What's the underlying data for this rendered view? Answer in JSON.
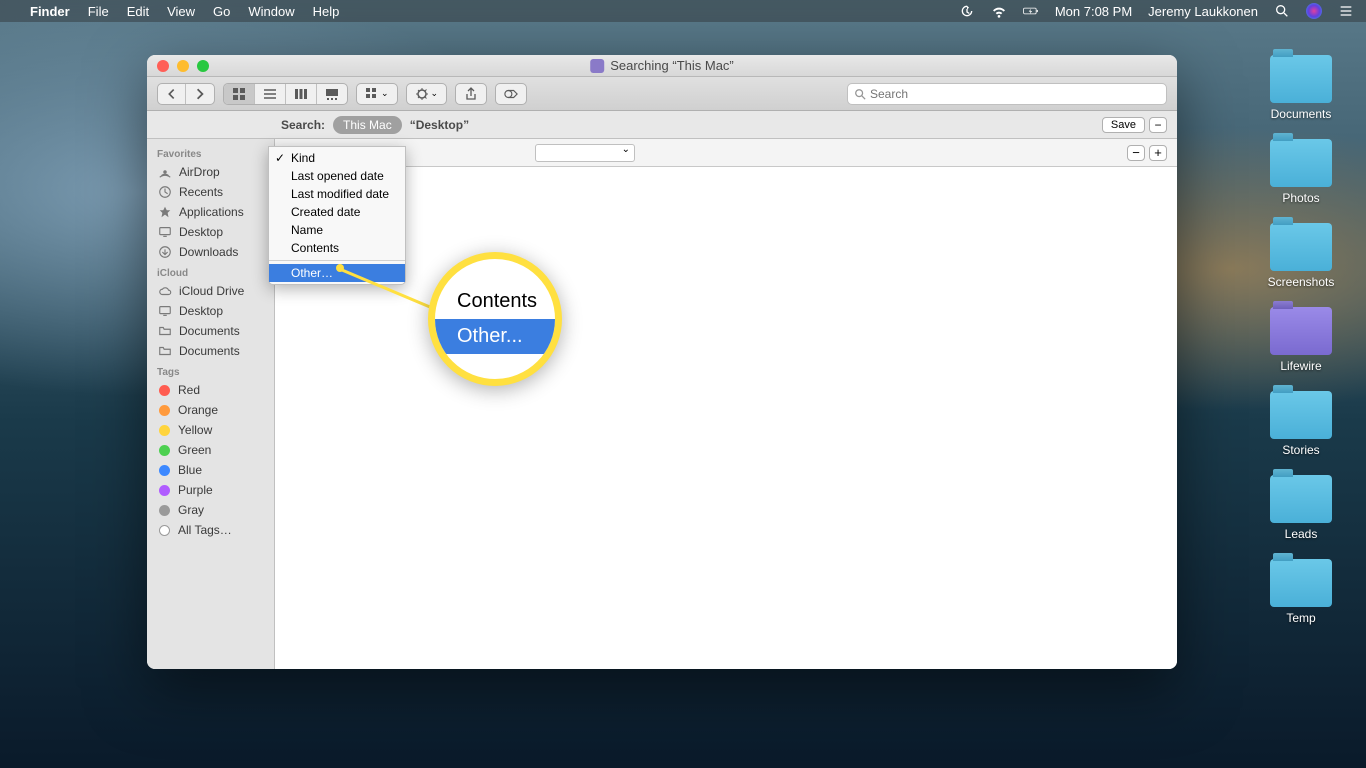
{
  "menubar": {
    "app": "Finder",
    "items": [
      "File",
      "Edit",
      "View",
      "Go",
      "Window",
      "Help"
    ],
    "clock": "Mon 7:08 PM",
    "user": "Jeremy Laukkonen"
  },
  "desktop_folders": [
    {
      "label": "Documents",
      "tint": "blue"
    },
    {
      "label": "Photos",
      "tint": "blue"
    },
    {
      "label": "Screenshots",
      "tint": "blue"
    },
    {
      "label": "Lifewire",
      "tint": "purple"
    },
    {
      "label": "Stories",
      "tint": "blue"
    },
    {
      "label": "Leads",
      "tint": "blue"
    },
    {
      "label": "Temp",
      "tint": "blue"
    }
  ],
  "window": {
    "title": "Searching “This Mac”",
    "search_placeholder": "Search",
    "scope": {
      "label": "Search:",
      "active": "This Mac",
      "other": "“Desktop”",
      "save": "Save"
    },
    "kind_menu": {
      "items": [
        "Kind",
        "Last opened date",
        "Last modified date",
        "Created date",
        "Name",
        "Contents"
      ],
      "checked": 0,
      "other": "Other…"
    },
    "magnifier": {
      "line1": "Contents",
      "line2": "Other..."
    }
  },
  "sidebar": {
    "sections": [
      {
        "title": "Favorites",
        "items": [
          {
            "label": "AirDrop",
            "icon": "airdrop"
          },
          {
            "label": "Recents",
            "icon": "clock"
          },
          {
            "label": "Applications",
            "icon": "apps"
          },
          {
            "label": "Desktop",
            "icon": "desktop"
          },
          {
            "label": "Downloads",
            "icon": "download"
          }
        ]
      },
      {
        "title": "iCloud",
        "items": [
          {
            "label": "iCloud Drive",
            "icon": "cloud"
          },
          {
            "label": "Desktop",
            "icon": "desktop"
          },
          {
            "label": "Documents",
            "icon": "folder"
          },
          {
            "label": "Documents",
            "icon": "folder"
          }
        ]
      }
    ],
    "tags_title": "Tags",
    "tags": [
      {
        "label": "Red",
        "color": "#ff5c50"
      },
      {
        "label": "Orange",
        "color": "#ff9a3c"
      },
      {
        "label": "Yellow",
        "color": "#ffd43c"
      },
      {
        "label": "Green",
        "color": "#4cd050"
      },
      {
        "label": "Blue",
        "color": "#3c88ff"
      },
      {
        "label": "Purple",
        "color": "#b05cff"
      },
      {
        "label": "Gray",
        "color": "#9a9a9a"
      }
    ],
    "all_tags": "All Tags…"
  }
}
